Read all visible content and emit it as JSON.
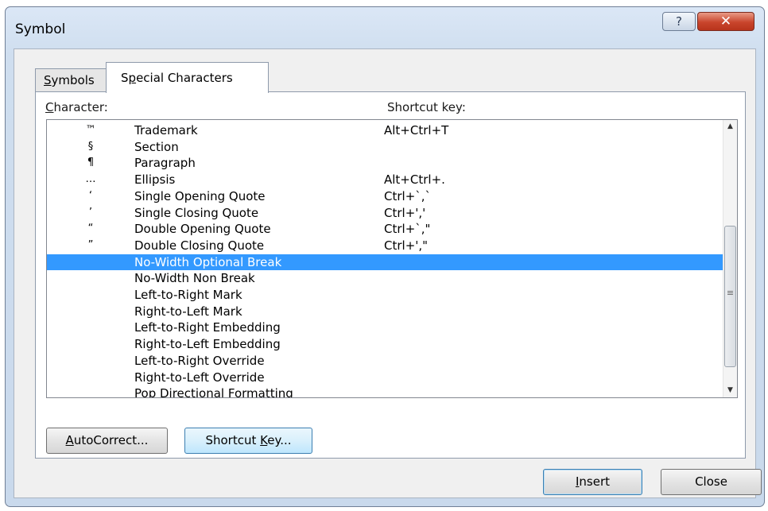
{
  "window": {
    "title": "Symbol",
    "help_glyph": "?",
    "close_glyph": "✕"
  },
  "tabs": {
    "symbols": {
      "mnemonic": "S",
      "rest": "ymbols"
    },
    "special": {
      "pre": "S",
      "mnemonic": "p",
      "rest": "ecial Characters"
    }
  },
  "headers": {
    "character": {
      "mnemonic": "C",
      "rest": "haracter:"
    },
    "shortcut": "Shortcut key:"
  },
  "list": {
    "selected_index": 8,
    "rows": [
      {
        "symbol": "™",
        "name": "Trademark",
        "shortcut": "Alt+Ctrl+T"
      },
      {
        "symbol": "§",
        "name": "Section",
        "shortcut": ""
      },
      {
        "symbol": "¶",
        "name": "Paragraph",
        "shortcut": ""
      },
      {
        "symbol": "…",
        "name": "Ellipsis",
        "shortcut": "Alt+Ctrl+."
      },
      {
        "symbol": "‘",
        "name": "Single Opening Quote",
        "shortcut": "Ctrl+`,`"
      },
      {
        "symbol": "’",
        "name": "Single Closing Quote",
        "shortcut": "Ctrl+',' "
      },
      {
        "symbol": "“",
        "name": "Double Opening Quote",
        "shortcut": "Ctrl+`,\""
      },
      {
        "symbol": "”",
        "name": "Double Closing Quote",
        "shortcut": "Ctrl+',\""
      },
      {
        "symbol": "",
        "name": "No-Width Optional Break",
        "shortcut": ""
      },
      {
        "symbol": "",
        "name": "No-Width Non Break",
        "shortcut": ""
      },
      {
        "symbol": "",
        "name": "Left-to-Right Mark",
        "shortcut": ""
      },
      {
        "symbol": "",
        "name": "Right-to-Left Mark",
        "shortcut": ""
      },
      {
        "symbol": "",
        "name": "Left-to-Right Embedding",
        "shortcut": ""
      },
      {
        "symbol": "",
        "name": "Right-to-Left Embedding",
        "shortcut": ""
      },
      {
        "symbol": "",
        "name": "Left-to-Right Override",
        "shortcut": ""
      },
      {
        "symbol": "",
        "name": "Right-to-Left Override",
        "shortcut": ""
      },
      {
        "symbol": "",
        "name": "Pop Directional Formatting",
        "shortcut": ""
      }
    ]
  },
  "buttons": {
    "autocorrect": {
      "mnemonic": "A",
      "rest": "utoCorrect..."
    },
    "shortcut": {
      "pre": "Shortcut ",
      "mnemonic": "K",
      "rest": "ey..."
    },
    "insert": {
      "mnemonic": "I",
      "rest": "nsert"
    },
    "close": "Close"
  },
  "icons": {
    "scroll_up": "up-arrow-icon",
    "scroll_down": "down-arrow-icon",
    "grip": "grip-icon"
  }
}
